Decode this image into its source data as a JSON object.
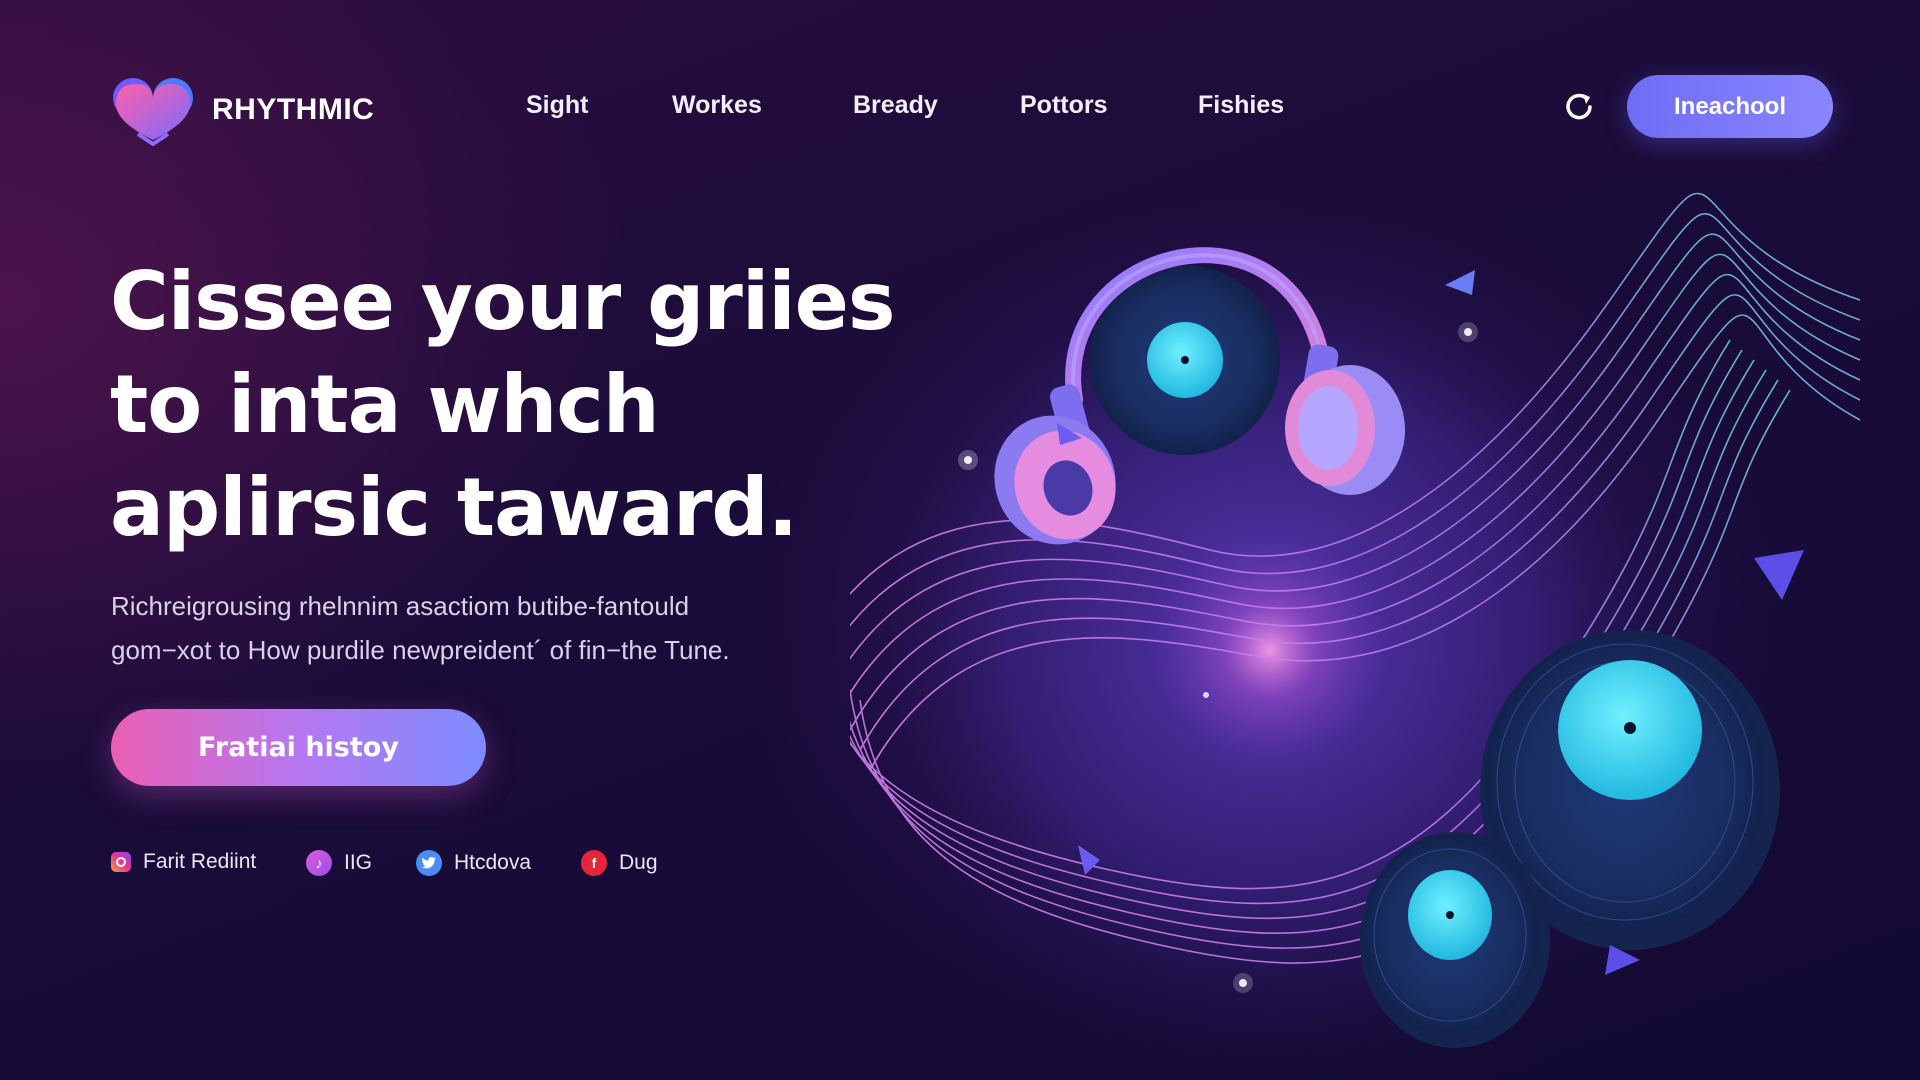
{
  "brand": {
    "name": "RHYTHMIC"
  },
  "nav": {
    "links": [
      "Sight",
      "Workes",
      "Bready",
      "Pottors",
      "Fishies"
    ],
    "refresh_icon": "refresh-icon",
    "cta_label": "Ineachool"
  },
  "hero": {
    "headline": [
      "Cissee your griies",
      "to inta whch",
      "aplirsic taward."
    ],
    "subtext": [
      "Richreigrousing rhelnnim asactiom butibe-fantould",
      "gom−xot to How purdile newpreident´ of fin−the Tune."
    ],
    "cta_label": "Fratiai histoy"
  },
  "socials": [
    {
      "label": "Farit Rediint",
      "icon": "instagram-icon"
    },
    {
      "label": "IIG",
      "icon": "music-icon"
    },
    {
      "label": "Htcdova",
      "icon": "twitter-icon"
    },
    {
      "label": "Dug",
      "icon": "facebook-icon"
    }
  ],
  "colors": {
    "background": "#1b0c3a",
    "accent_purple": "#7d7af8",
    "accent_pink": "#ea5fb4",
    "vinyl_cyan": "#35d6f0"
  }
}
